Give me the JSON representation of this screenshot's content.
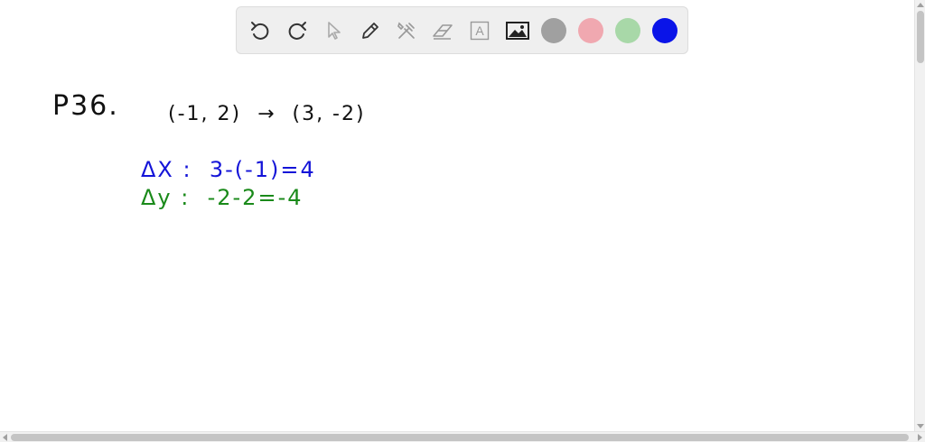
{
  "toolbar": {
    "tools": [
      {
        "name": "undo-icon"
      },
      {
        "name": "redo-icon"
      },
      {
        "name": "select-pointer-icon"
      },
      {
        "name": "pen-icon"
      },
      {
        "name": "tools-icon"
      },
      {
        "name": "eraser-icon"
      },
      {
        "name": "text-box-icon",
        "glyph": "A"
      },
      {
        "name": "image-icon"
      }
    ],
    "colors": [
      "#a0a0a0",
      "#f0a8b0",
      "#a8d8a8",
      "#0a14e8"
    ]
  },
  "ink": {
    "problem_number": "P36.",
    "points": "(-1, 2)  →  (3, -2)",
    "delta_x": "ΔX :  3-(-1)=4",
    "delta_y": "Δy :  -2-2=-4",
    "colors": {
      "black": "#111111",
      "blue": "#1414d8",
      "green": "#1a8a1a"
    }
  }
}
